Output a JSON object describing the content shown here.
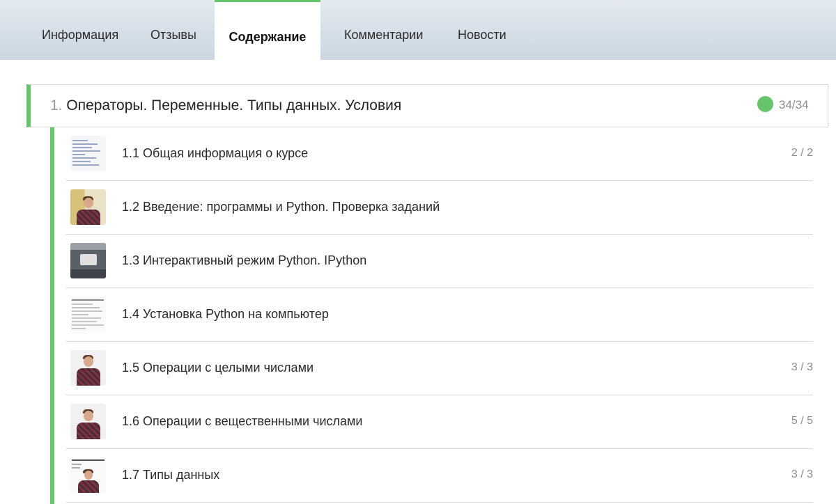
{
  "tabs": [
    {
      "label": "Информация",
      "active": false
    },
    {
      "label": "Отзывы",
      "active": false
    },
    {
      "label": "Содержание",
      "active": true
    },
    {
      "label": "Комментарии",
      "active": false
    },
    {
      "label": "Новости",
      "active": false
    }
  ],
  "module": {
    "number": "1.",
    "title": "Операторы. Переменные. Типы данных. Условия",
    "progress": "34/34",
    "status_color": "#66c56b"
  },
  "lessons": [
    {
      "title": "1.1 Общая информация о курсе",
      "progress": "2 / 2",
      "thumb": "code"
    },
    {
      "title": "1.2 Введение: программы и Python. Проверка заданий",
      "progress": "",
      "thumb": "video-board"
    },
    {
      "title": "1.3 Интерактивный режим Python. IPython",
      "progress": "",
      "thumb": "dark-screen"
    },
    {
      "title": "1.4 Установка Python на компьютер",
      "progress": "",
      "thumb": "document"
    },
    {
      "title": "1.5 Операции с целыми числами",
      "progress": "3 / 3",
      "thumb": "video"
    },
    {
      "title": "1.6 Операции с вещественными числами",
      "progress": "5 / 5",
      "thumb": "video"
    },
    {
      "title": "1.7 Типы данных",
      "progress": "3 / 3",
      "thumb": "video-slide"
    }
  ],
  "colors": {
    "accent": "#66c56b",
    "tabbar_top": "#e3e9ef",
    "tabbar_bottom": "#cbd7e2",
    "muted": "#8c8c8c"
  }
}
